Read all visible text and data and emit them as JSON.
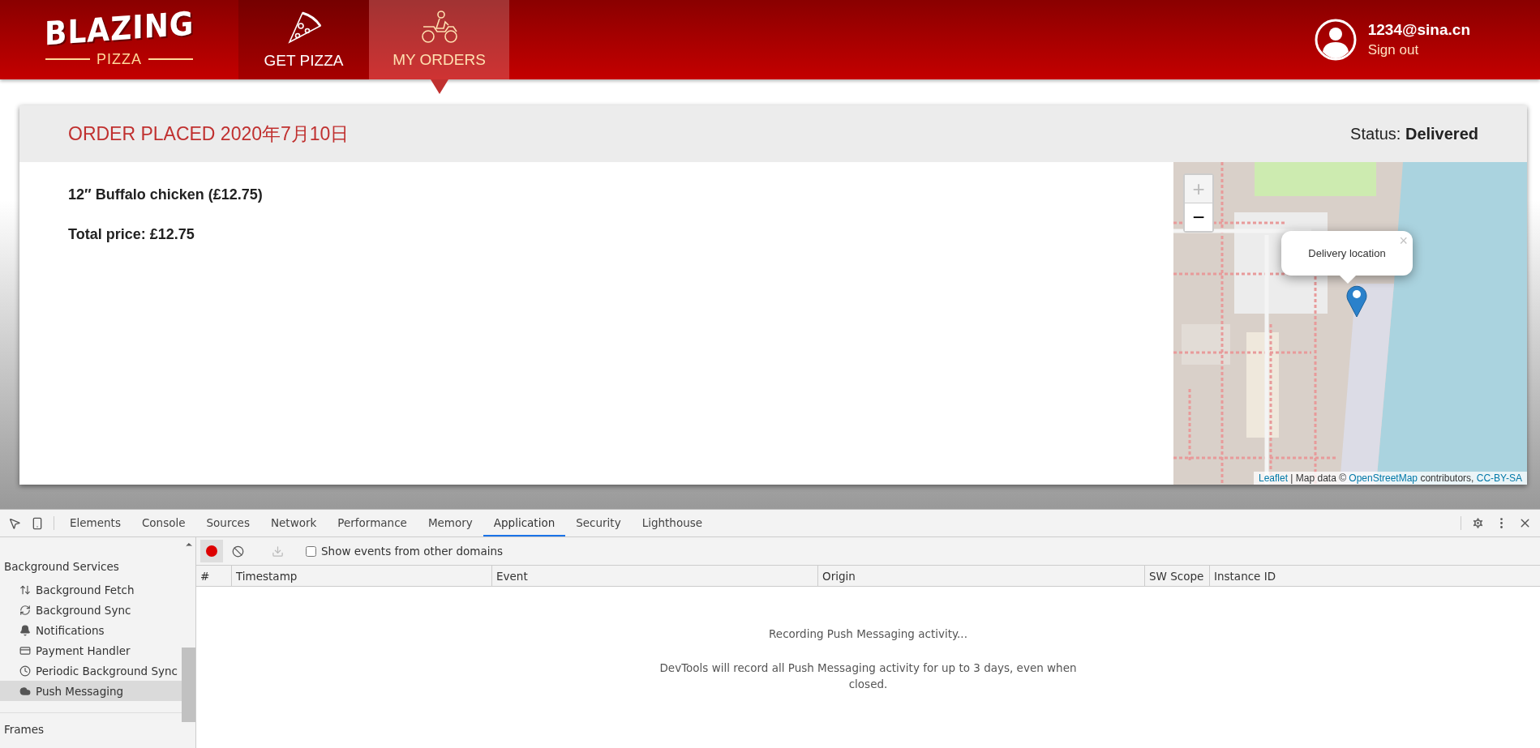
{
  "header": {
    "logo": {
      "title": "BLAZING",
      "subtitle": "PIZZA"
    },
    "nav": [
      {
        "label": "GET PIZZA",
        "selected": false
      },
      {
        "label": "MY ORDERS",
        "selected": true
      }
    ],
    "user": {
      "email": "1234@sina.cn",
      "link": "Sign out"
    }
  },
  "order": {
    "title": "ORDER PLACED 2020年7月10日",
    "status_label": "Status:",
    "status": "Delivered",
    "items": [
      "12″ Buffalo chicken (£12.75)"
    ],
    "total": "Total price: £12.75",
    "map": {
      "kind": "picture",
      "zoom_in": "+",
      "zoom_out": "−",
      "popup": "Delivery location",
      "popup_close": "×",
      "attribution": [
        {
          "text": "Leaflet",
          "link": true
        },
        {
          "text": " | Map data © ",
          "link": false
        },
        {
          "text": "OpenStreetMap",
          "link": true
        },
        {
          "text": " contributors, ",
          "link": false
        },
        {
          "text": "CC-BY-SA",
          "link": true
        }
      ]
    }
  },
  "devtools": {
    "tabs": [
      {
        "label": "Elements",
        "selected": false
      },
      {
        "label": "Console",
        "selected": false
      },
      {
        "label": "Sources",
        "selected": false
      },
      {
        "label": "Network",
        "selected": false
      },
      {
        "label": "Performance",
        "selected": false
      },
      {
        "label": "Memory",
        "selected": false
      },
      {
        "label": "Application",
        "selected": true
      },
      {
        "label": "Security",
        "selected": false
      },
      {
        "label": "Lighthouse",
        "selected": false
      }
    ],
    "sidebar": [
      {
        "kind": "section",
        "label": "Background Services"
      },
      {
        "kind": "item",
        "label": "Background Fetch",
        "selected": false
      },
      {
        "kind": "item",
        "label": "Background Sync",
        "selected": false
      },
      {
        "kind": "item",
        "label": "Notifications",
        "selected": false
      },
      {
        "kind": "item",
        "label": "Payment Handler",
        "selected": false
      },
      {
        "kind": "item",
        "label": "Periodic Background Sync",
        "selected": false
      },
      {
        "kind": "item",
        "label": "Push Messaging",
        "selected": true
      },
      {
        "kind": "section",
        "label": "Frames"
      }
    ],
    "toolbar": {
      "recording": true,
      "download_disabled": true,
      "checkbox": {
        "label": "Show events from other domains",
        "checked": false
      }
    },
    "columns": [
      "#",
      "Timestamp",
      "Event",
      "Origin",
      "SW Scope",
      "Instance ID"
    ],
    "empty": {
      "title": "Recording Push Messaging activity...",
      "text": "DevTools will record all Push Messaging activity for up to 3 days, even when closed."
    }
  }
}
